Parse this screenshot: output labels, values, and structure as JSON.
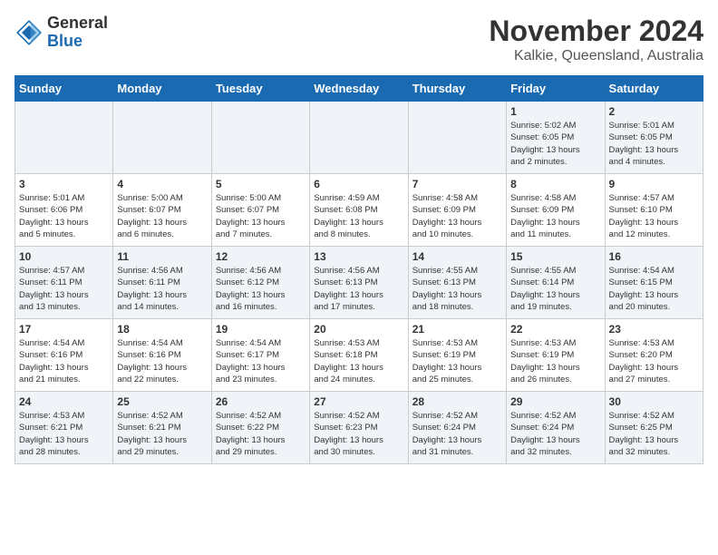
{
  "logo": {
    "general": "General",
    "blue": "Blue"
  },
  "title": "November 2024",
  "subtitle": "Kalkie, Queensland, Australia",
  "days_of_week": [
    "Sunday",
    "Monday",
    "Tuesday",
    "Wednesday",
    "Thursday",
    "Friday",
    "Saturday"
  ],
  "weeks": [
    [
      {
        "day": "",
        "info": ""
      },
      {
        "day": "",
        "info": ""
      },
      {
        "day": "",
        "info": ""
      },
      {
        "day": "",
        "info": ""
      },
      {
        "day": "",
        "info": ""
      },
      {
        "day": "1",
        "info": "Sunrise: 5:02 AM\nSunset: 6:05 PM\nDaylight: 13 hours\nand 2 minutes."
      },
      {
        "day": "2",
        "info": "Sunrise: 5:01 AM\nSunset: 6:05 PM\nDaylight: 13 hours\nand 4 minutes."
      }
    ],
    [
      {
        "day": "3",
        "info": "Sunrise: 5:01 AM\nSunset: 6:06 PM\nDaylight: 13 hours\nand 5 minutes."
      },
      {
        "day": "4",
        "info": "Sunrise: 5:00 AM\nSunset: 6:07 PM\nDaylight: 13 hours\nand 6 minutes."
      },
      {
        "day": "5",
        "info": "Sunrise: 5:00 AM\nSunset: 6:07 PM\nDaylight: 13 hours\nand 7 minutes."
      },
      {
        "day": "6",
        "info": "Sunrise: 4:59 AM\nSunset: 6:08 PM\nDaylight: 13 hours\nand 8 minutes."
      },
      {
        "day": "7",
        "info": "Sunrise: 4:58 AM\nSunset: 6:09 PM\nDaylight: 13 hours\nand 10 minutes."
      },
      {
        "day": "8",
        "info": "Sunrise: 4:58 AM\nSunset: 6:09 PM\nDaylight: 13 hours\nand 11 minutes."
      },
      {
        "day": "9",
        "info": "Sunrise: 4:57 AM\nSunset: 6:10 PM\nDaylight: 13 hours\nand 12 minutes."
      }
    ],
    [
      {
        "day": "10",
        "info": "Sunrise: 4:57 AM\nSunset: 6:11 PM\nDaylight: 13 hours\nand 13 minutes."
      },
      {
        "day": "11",
        "info": "Sunrise: 4:56 AM\nSunset: 6:11 PM\nDaylight: 13 hours\nand 14 minutes."
      },
      {
        "day": "12",
        "info": "Sunrise: 4:56 AM\nSunset: 6:12 PM\nDaylight: 13 hours\nand 16 minutes."
      },
      {
        "day": "13",
        "info": "Sunrise: 4:56 AM\nSunset: 6:13 PM\nDaylight: 13 hours\nand 17 minutes."
      },
      {
        "day": "14",
        "info": "Sunrise: 4:55 AM\nSunset: 6:13 PM\nDaylight: 13 hours\nand 18 minutes."
      },
      {
        "day": "15",
        "info": "Sunrise: 4:55 AM\nSunset: 6:14 PM\nDaylight: 13 hours\nand 19 minutes."
      },
      {
        "day": "16",
        "info": "Sunrise: 4:54 AM\nSunset: 6:15 PM\nDaylight: 13 hours\nand 20 minutes."
      }
    ],
    [
      {
        "day": "17",
        "info": "Sunrise: 4:54 AM\nSunset: 6:16 PM\nDaylight: 13 hours\nand 21 minutes."
      },
      {
        "day": "18",
        "info": "Sunrise: 4:54 AM\nSunset: 6:16 PM\nDaylight: 13 hours\nand 22 minutes."
      },
      {
        "day": "19",
        "info": "Sunrise: 4:54 AM\nSunset: 6:17 PM\nDaylight: 13 hours\nand 23 minutes."
      },
      {
        "day": "20",
        "info": "Sunrise: 4:53 AM\nSunset: 6:18 PM\nDaylight: 13 hours\nand 24 minutes."
      },
      {
        "day": "21",
        "info": "Sunrise: 4:53 AM\nSunset: 6:19 PM\nDaylight: 13 hours\nand 25 minutes."
      },
      {
        "day": "22",
        "info": "Sunrise: 4:53 AM\nSunset: 6:19 PM\nDaylight: 13 hours\nand 26 minutes."
      },
      {
        "day": "23",
        "info": "Sunrise: 4:53 AM\nSunset: 6:20 PM\nDaylight: 13 hours\nand 27 minutes."
      }
    ],
    [
      {
        "day": "24",
        "info": "Sunrise: 4:53 AM\nSunset: 6:21 PM\nDaylight: 13 hours\nand 28 minutes."
      },
      {
        "day": "25",
        "info": "Sunrise: 4:52 AM\nSunset: 6:21 PM\nDaylight: 13 hours\nand 29 minutes."
      },
      {
        "day": "26",
        "info": "Sunrise: 4:52 AM\nSunset: 6:22 PM\nDaylight: 13 hours\nand 29 minutes."
      },
      {
        "day": "27",
        "info": "Sunrise: 4:52 AM\nSunset: 6:23 PM\nDaylight: 13 hours\nand 30 minutes."
      },
      {
        "day": "28",
        "info": "Sunrise: 4:52 AM\nSunset: 6:24 PM\nDaylight: 13 hours\nand 31 minutes."
      },
      {
        "day": "29",
        "info": "Sunrise: 4:52 AM\nSunset: 6:24 PM\nDaylight: 13 hours\nand 32 minutes."
      },
      {
        "day": "30",
        "info": "Sunrise: 4:52 AM\nSunset: 6:25 PM\nDaylight: 13 hours\nand 32 minutes."
      }
    ]
  ]
}
